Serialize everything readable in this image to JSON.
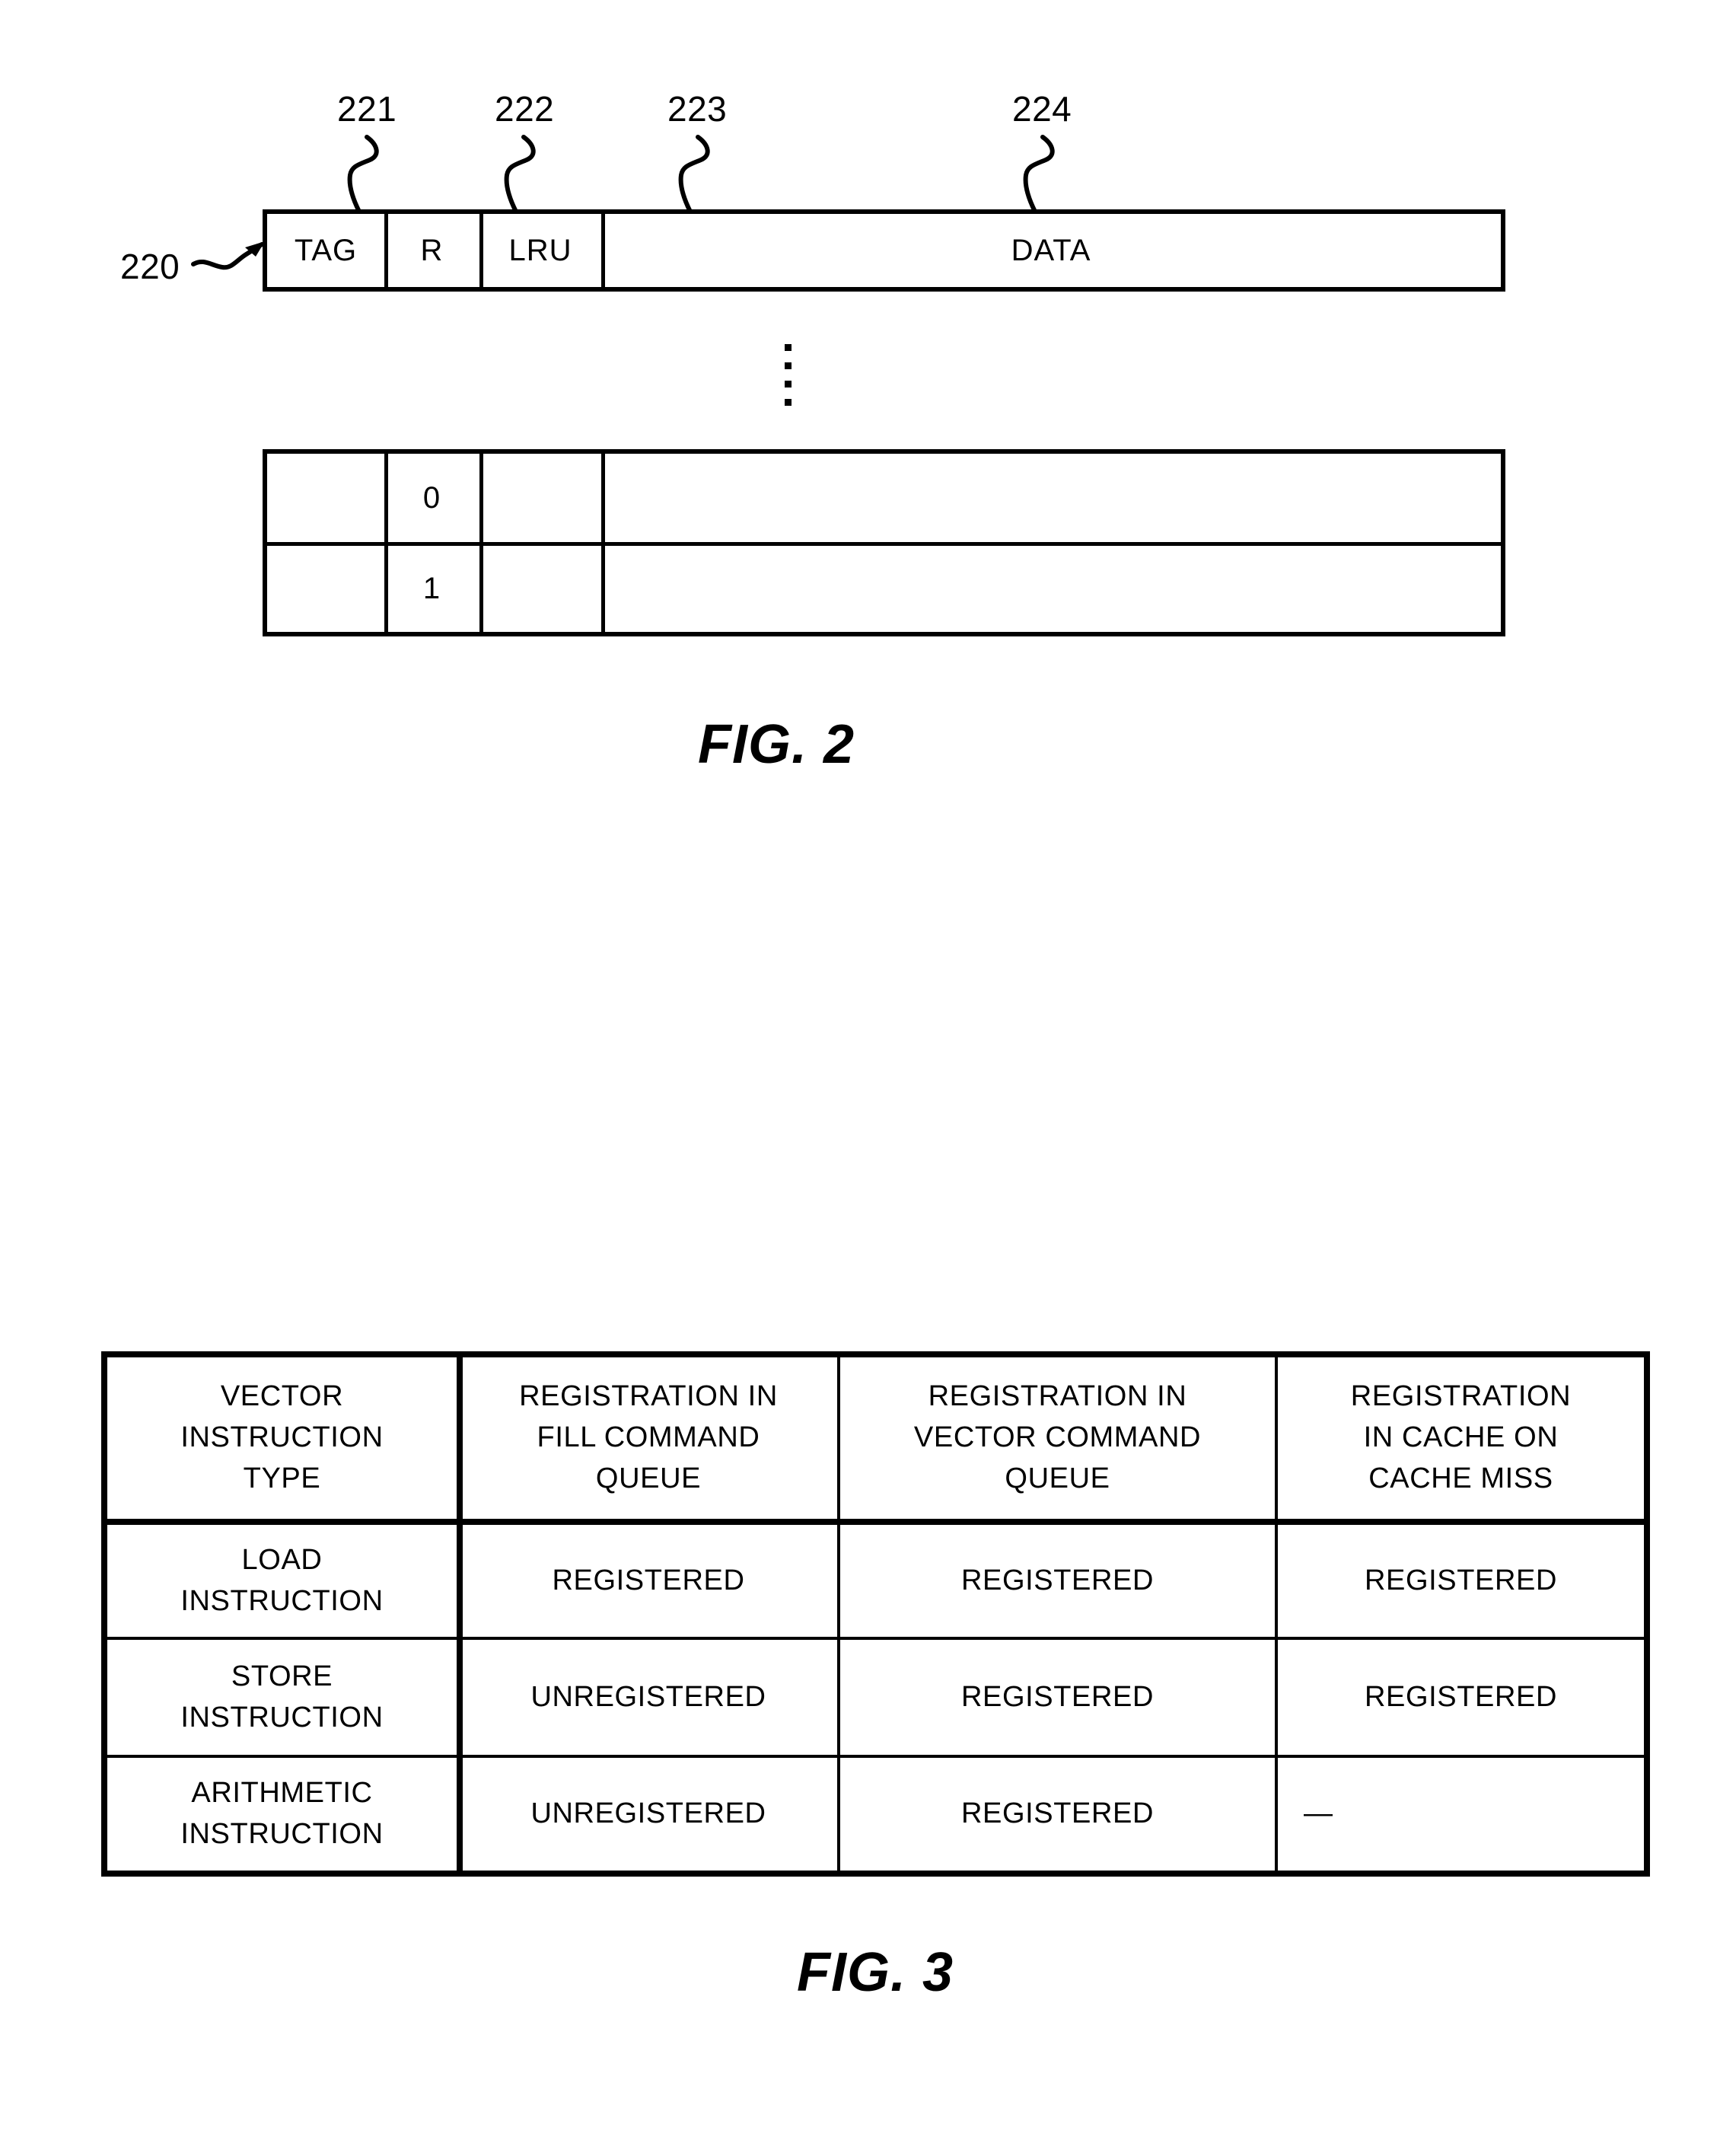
{
  "figures": [
    {
      "id": "fig2",
      "caption": "FIG. 2",
      "reference_labels": [
        {
          "name": "entry-ref",
          "text": "220"
        },
        {
          "name": "tag-ref",
          "text": "221"
        },
        {
          "name": "r-ref",
          "text": "222"
        },
        {
          "name": "lru-ref",
          "text": "223"
        },
        {
          "name": "data-ref",
          "text": "224"
        }
      ],
      "cache_entry_row": {
        "columns": [
          "TAG",
          "R",
          "LRU",
          "DATA"
        ]
      },
      "ellipsis": "⋮",
      "lower_rows": [
        {
          "tag": "",
          "r": "0",
          "lru": "",
          "data": ""
        },
        {
          "tag": "",
          "r": "1",
          "lru": "",
          "data": ""
        }
      ]
    },
    {
      "id": "fig3",
      "caption": "FIG. 3",
      "table": {
        "headers": [
          [
            "VECTOR",
            "INSTRUCTION",
            "TYPE"
          ],
          [
            "REGISTRATION IN",
            "FILL COMMAND",
            "QUEUE"
          ],
          [
            "REGISTRATION IN",
            "VECTOR COMMAND",
            "QUEUE"
          ],
          [
            "REGISTRATION",
            "IN CACHE ON",
            "CACHE MISS"
          ]
        ],
        "rows": [
          {
            "type": [
              "LOAD",
              "INSTRUCTION"
            ],
            "fill_command_queue": [
              "REGISTERED"
            ],
            "vector_command_queue": [
              "REGISTERED"
            ],
            "cache_on_miss": [
              "REGISTERED"
            ],
            "cache_on_miss_align": "center"
          },
          {
            "type": [
              "STORE",
              "INSTRUCTION"
            ],
            "fill_command_queue": [
              "UNREGISTERED"
            ],
            "vector_command_queue": [
              "REGISTERED"
            ],
            "cache_on_miss": [
              "REGISTERED"
            ],
            "cache_on_miss_align": "center"
          },
          {
            "type": [
              "ARITHMETIC",
              "INSTRUCTION"
            ],
            "fill_command_queue": [
              "UNREGISTERED"
            ],
            "vector_command_queue": [
              "REGISTERED"
            ],
            "cache_on_miss": [
              "—"
            ],
            "cache_on_miss_align": "left"
          }
        ]
      }
    }
  ],
  "colors": {
    "ink": "#000000",
    "paper": "#ffffff"
  }
}
